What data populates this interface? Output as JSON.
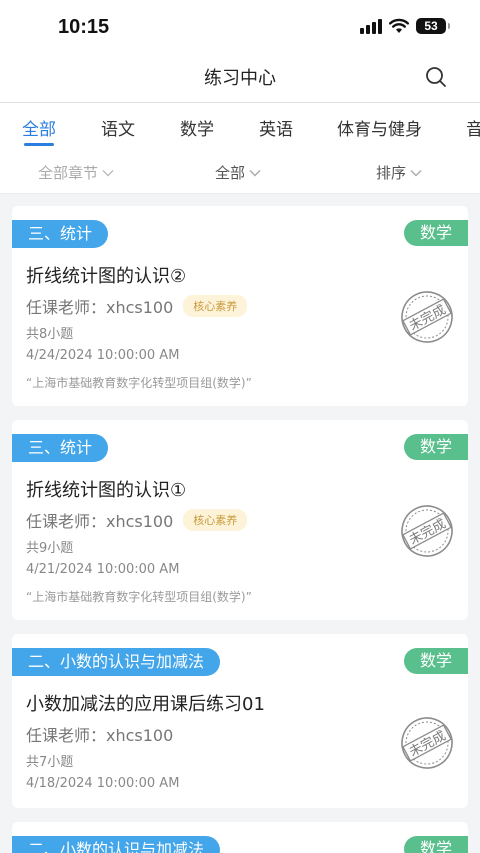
{
  "status_bar": {
    "time": "10:15",
    "battery": "53"
  },
  "header": {
    "title": "练习中心"
  },
  "tabs": [
    {
      "label": "全部"
    },
    {
      "label": "语文"
    },
    {
      "label": "数学"
    },
    {
      "label": "英语"
    },
    {
      "label": "体育与健身"
    },
    {
      "label": "音"
    }
  ],
  "filters": {
    "chapter": "全部章节",
    "status": "全部",
    "sort": "排序"
  },
  "stamp_text": "未完成",
  "cards": [
    {
      "chapter": "三、统计",
      "subject": "数学",
      "title": "折线统计图的认识②",
      "teacher": "任课老师：xhcs100",
      "tag": "核心素养",
      "count": "共8小题",
      "date": "4/24/2024 10:00:00 AM",
      "source": "“上海市基础教育数字化转型项目组(数学)”"
    },
    {
      "chapter": "三、统计",
      "subject": "数学",
      "title": "折线统计图的认识①",
      "teacher": "任课老师：xhcs100",
      "tag": "核心素养",
      "count": "共9小题",
      "date": "4/21/2024 10:00:00 AM",
      "source": "“上海市基础教育数字化转型项目组(数学)”"
    },
    {
      "chapter": "二、小数的认识与加减法",
      "subject": "数学",
      "title": "小数加减法的应用课后练习01",
      "teacher": "任课老师：xhcs100",
      "count": "共7小题",
      "date": "4/18/2024 10:00:00 AM"
    },
    {
      "chapter": "二、小数的认识与加减法",
      "subject": "数学"
    }
  ],
  "colors": {
    "accent": "#2b7de0",
    "chapter_bg": "#43a6ea",
    "subject_bg": "#59bf8d",
    "tag_text": "#c9993a",
    "tag_bg": "#fdf3d9"
  }
}
